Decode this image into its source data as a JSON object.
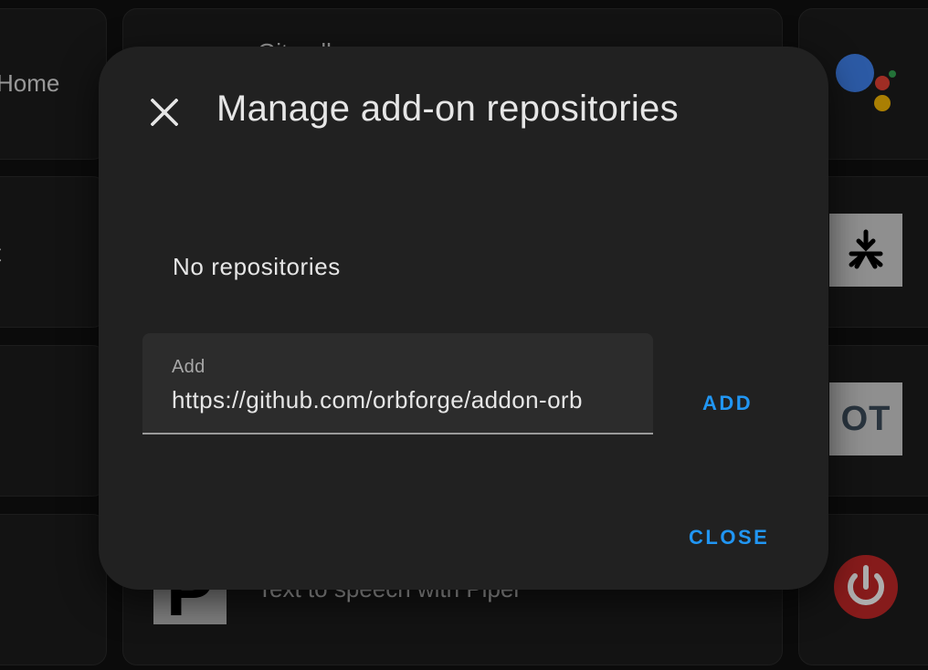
{
  "background": {
    "cards": {
      "top_left_label": "Home",
      "middle_left_label": "t",
      "top_center_label": "Git pull",
      "bottom_center_label": "Text to speech with Piper",
      "bottom_center_logo_letter": "P",
      "right_mid2_logo_text": "OT"
    },
    "icons": {
      "assistant": "google-assistant-dots-icon",
      "matter": "matter-logo-icon",
      "power": "power-icon",
      "piper": "piper-logo-icon"
    }
  },
  "dialog": {
    "title": "Manage add-on repositories",
    "empty_text": "No repositories",
    "add_field": {
      "label": "Add",
      "value": "https://github.com/orbforge/addon-orb",
      "placeholder": ""
    },
    "add_button_label": "ADD",
    "close_button_label": "CLOSE",
    "close_icon": "close-icon"
  },
  "colors": {
    "accent": "#2196f3",
    "dialog_background": "#212121",
    "page_background": "#111111"
  }
}
